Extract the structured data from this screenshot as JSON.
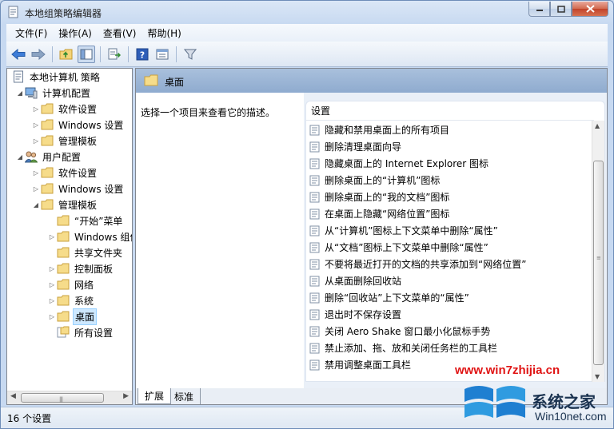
{
  "window": {
    "title": "本地组策略编辑器"
  },
  "menubar": [
    "文件(F)",
    "操作(A)",
    "查看(V)",
    "帮助(H)"
  ],
  "tree": [
    {
      "label": "本地计算机 策略",
      "level": 0,
      "arrow": "",
      "icon": "policy-doc-icon"
    },
    {
      "label": "计算机配置",
      "level": 1,
      "arrow": "expanded",
      "icon": "computer-icon"
    },
    {
      "label": "软件设置",
      "level": 2,
      "arrow": "collapsed",
      "icon": "folder-icon"
    },
    {
      "label": "Windows 设置",
      "level": 2,
      "arrow": "collapsed",
      "icon": "folder-icon"
    },
    {
      "label": "管理模板",
      "level": 2,
      "arrow": "collapsed",
      "icon": "folder-icon"
    },
    {
      "label": "用户配置",
      "level": 1,
      "arrow": "expanded",
      "icon": "users-icon"
    },
    {
      "label": "软件设置",
      "level": 2,
      "arrow": "collapsed",
      "icon": "folder-icon"
    },
    {
      "label": "Windows 设置",
      "level": 2,
      "arrow": "collapsed",
      "icon": "folder-icon"
    },
    {
      "label": "管理模板",
      "level": 2,
      "arrow": "expanded",
      "icon": "folder-icon"
    },
    {
      "label": "“开始”菜单",
      "level": 3,
      "arrow": "",
      "icon": "folder-icon"
    },
    {
      "label": "Windows 组件",
      "level": 3,
      "arrow": "collapsed",
      "icon": "folder-icon"
    },
    {
      "label": "共享文件夹",
      "level": 3,
      "arrow": "",
      "icon": "folder-icon"
    },
    {
      "label": "控制面板",
      "level": 3,
      "arrow": "collapsed",
      "icon": "folder-icon"
    },
    {
      "label": "网络",
      "level": 3,
      "arrow": "collapsed",
      "icon": "folder-icon"
    },
    {
      "label": "系统",
      "level": 3,
      "arrow": "collapsed",
      "icon": "folder-icon"
    },
    {
      "label": "桌面",
      "level": 3,
      "arrow": "collapsed",
      "icon": "folder-icon",
      "selected": true
    },
    {
      "label": "所有设置",
      "level": 3,
      "arrow": "",
      "icon": "all-settings-icon"
    }
  ],
  "content": {
    "folder_title": "桌面",
    "description": "选择一个项目来查看它的描述。",
    "column_header": "设置",
    "items": [
      "隐藏和禁用桌面上的所有项目",
      "删除清理桌面向导",
      "隐藏桌面上的 Internet Explorer 图标",
      "删除桌面上的“计算机”图标",
      "删除桌面上的“我的文档”图标",
      "在桌面上隐藏“网络位置”图标",
      "从“计算机”图标上下文菜单中删除“属性”",
      "从“文档”图标上下文菜单中删除“属性”",
      "不要将最近打开的文档的共享添加到“网络位置”",
      "从桌面删除回收站",
      "删除“回收站”上下文菜单的“属性”",
      "退出时不保存设置",
      "关闭 Aero Shake 窗口最小化鼠标手势",
      "禁止添加、拖、放和关闭任务栏的工具栏",
      "禁用调整桌面工具栏"
    ]
  },
  "tabs": [
    "扩展",
    "标准"
  ],
  "status": "16 个设置",
  "watermark": {
    "url": "www.win7zhijia.cn",
    "name": "系统之家",
    "site": "Win10net.com"
  },
  "colors": {
    "selection": "#cde8ff",
    "header": "#9bb5d6",
    "watermark_red": "#e01414"
  }
}
